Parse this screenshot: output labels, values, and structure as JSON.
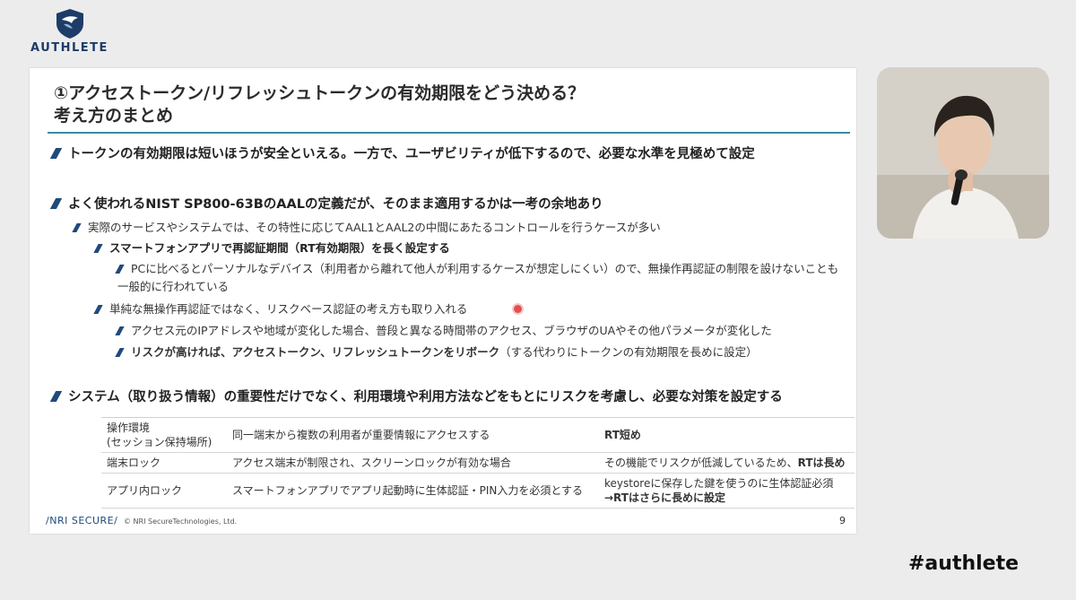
{
  "logo": {
    "name": "AUTHLETE"
  },
  "slide": {
    "title_line1": "①アクセストークン/リフレッシュトークンの有効期限をどう決める？",
    "title_line2": "考え方のまとめ",
    "bullets": [
      "トークンの有効期限は短いほうが安全といえる。一方で、ユーザビリティが低下するので、必要な水準を見極めて設定",
      "よく使われるNIST SP800-63BのAALの定義だが、そのまま適用するかは一考の余地あり",
      "実際のサービスやシステムでは、その特性に応じてAAL1とAAL2の中間にあたるコントロールを行うケースが多い",
      "スマートフォンアプリで再認証期間（RT有効期限）を長く設定する",
      "PCに比べるとパーソナルなデバイス（利用者から離れて他人が利用するケースが想定しにくい）ので、無操作再認証の制限を設けないことも一般的に行われている",
      "単純な無操作再認証ではなく、リスクベース認証の考え方も取り入れる",
      "アクセス元のIPアドレスや地域が変化した場合、普段と異なる時間帯のアクセス、ブラウザのUAやその他パラメータが変化した",
      "リスクが高ければ、アクセストークン、リフレッシュトークンをリボーク",
      "（する代わりにトークンの有効期限を長めに設定）",
      "システム（取り扱う情報）の重要性だけでなく、利用環境や利用方法などをもとにリスクを考慮し、必要な対策を設定する"
    ],
    "table": [
      {
        "c1": "操作環境\n(セッション保持場所)",
        "c2": "同一端末から複数の利用者が重要情報にアクセスする",
        "c3a": "RT短め",
        "c3b": ""
      },
      {
        "c1": "端末ロック",
        "c2": "アクセス端末が制限され、スクリーンロックが有効な場合",
        "c3a": "その機能でリスクが低減しているため、",
        "c3b": "RTは長め"
      },
      {
        "c1": "アプリ内ロック",
        "c2": "スマートフォンアプリでアプリ起動時に生体認証・PIN入力を必須とする",
        "c3a": "keystoreに保存した鍵を使うのに生体認証必須",
        "c3b": "→RTはさらに長めに設定"
      }
    ],
    "footer_logo": "NRI SECURE",
    "footer_copy": "© NRI SecureTechnologies, Ltd.",
    "page_number": "9"
  },
  "hashtag": "#authlete",
  "colors": {
    "accent": "#1f4a7a",
    "rule": "#3c8ba0",
    "brand": "#1d3c67"
  }
}
